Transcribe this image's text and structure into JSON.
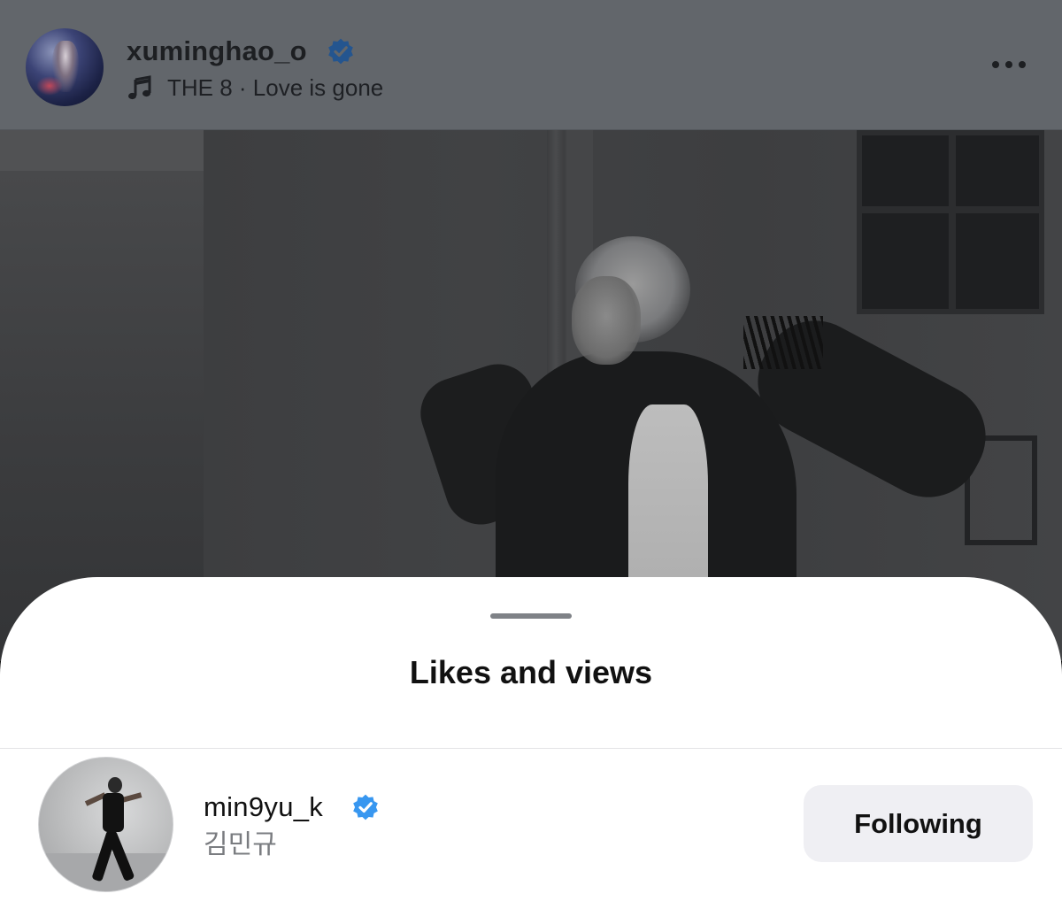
{
  "post": {
    "username": "xuminghao_o",
    "verified": true,
    "music": "THE 8 · Love is gone",
    "icons": {
      "verified": "verified-badge-icon",
      "music": "music-note-icon",
      "more": "more-options-icon"
    }
  },
  "sheet": {
    "title": "Likes and views",
    "users": [
      {
        "username": "min9yu_k",
        "verified": true,
        "full_name": "김민규",
        "follow_label": "Following"
      }
    ]
  },
  "colors": {
    "header_bg": "#62666b",
    "verified_top": "#24558f",
    "verified_blue": "#3897f0",
    "button_bg": "#efeff3",
    "secondary_text": "#7a7c80"
  }
}
